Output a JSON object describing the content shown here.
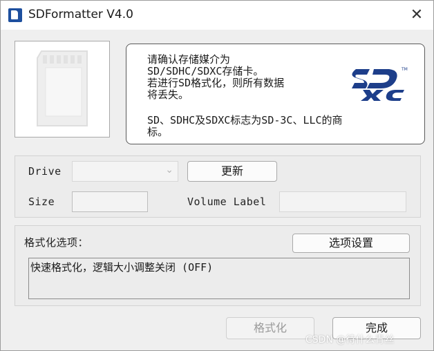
{
  "window": {
    "title": "SDFormatter V4.0"
  },
  "info": {
    "line1": "请确认存储媒介为\nSD/SDHC/SDXC存储卡。\n若进行SD格式化，则所有数据\n将丢失。",
    "line2": "SD、SDHC及SDXC标志为SD-3C、LLC的商\n标。"
  },
  "drive": {
    "label": "Drive",
    "value": "",
    "refresh_label": "更新",
    "size_label": "Size",
    "size_value": "",
    "volume_label": "Volume Label",
    "volume_value": ""
  },
  "options": {
    "heading": "格式化选项：",
    "settings_label": "选项设置",
    "summary": "快速格式化，逻辑大小调整关闭 (OFF)"
  },
  "actions": {
    "format_label": "格式化",
    "done_label": "完成"
  },
  "watermark": "CSDN @待什么青丝",
  "colors": {
    "sd_logo": "#1d3e8a",
    "title_bg": "#ffffff"
  }
}
